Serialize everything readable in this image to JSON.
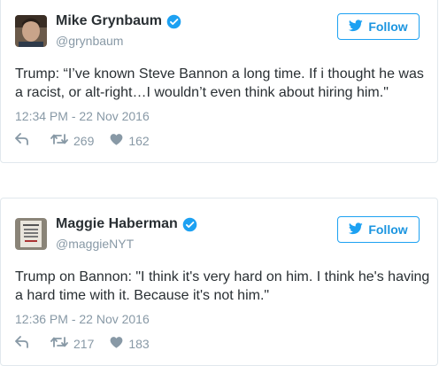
{
  "tweets": [
    {
      "name": "Mike Grynbaum",
      "handle": "@grynbaum",
      "follow_label": "Follow",
      "text": "Trump: “I’ve known Steve Bannon a long time. If i thought he was a racist, or alt-right…I wouldn’t even think about hiring him.\"",
      "timestamp": "12:34 PM - 22 Nov 2016",
      "retweets": "269",
      "likes": "162"
    },
    {
      "name": "Maggie Haberman",
      "handle": "@maggieNYT",
      "follow_label": "Follow",
      "text": "Trump on Bannon: \"I think it's very hard on him. I think he's having a hard time with it. Because it's not him.\"",
      "timestamp": "12:36 PM - 22 Nov 2016",
      "retweets": "217",
      "likes": "183"
    }
  ],
  "icons": {
    "verified": "verified-badge-icon",
    "bird": "twitter-bird-icon",
    "reply": "reply-icon",
    "retweet": "retweet-icon",
    "like": "heart-icon"
  },
  "colors": {
    "accent": "#1da1f2",
    "muted": "#8899a6",
    "text": "#292f33",
    "border": "#e1e8ed"
  }
}
